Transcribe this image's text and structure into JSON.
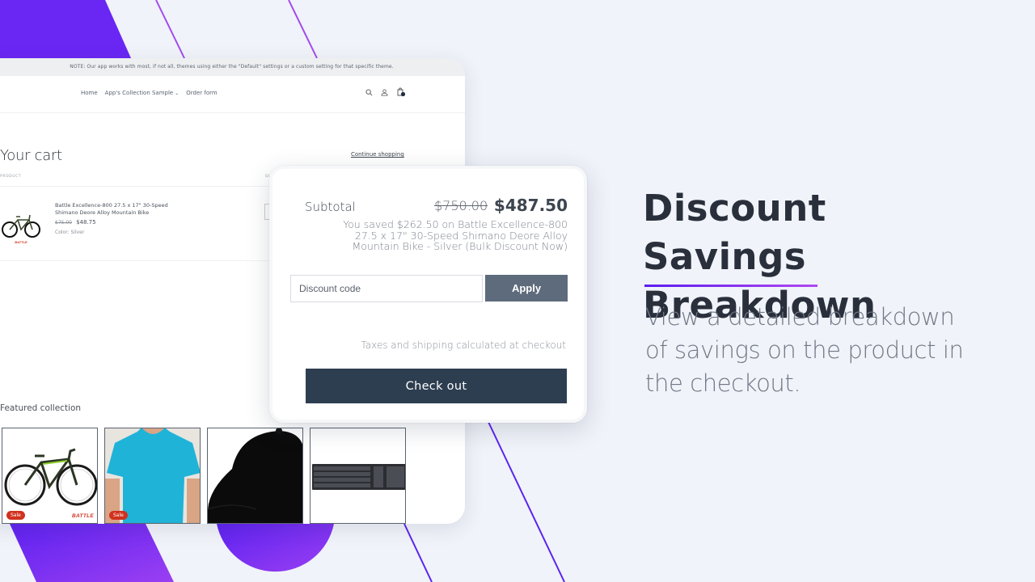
{
  "theme": {
    "accent_purple": "#6a2cf5",
    "checkout_button": "#2e3e51",
    "apply_button": "#5d6b7c",
    "sale_badge": "#d0321f",
    "background": "#f0f3f9"
  },
  "store": {
    "notice": "NOTE: Our app works with most, if not all, themes using either the \"Default\" settings or a custom setting for that specific theme.",
    "nav": {
      "links": [
        {
          "label": "Home"
        },
        {
          "label": "App's Collection Sample",
          "has_dropdown": true
        },
        {
          "label": "Order form"
        }
      ],
      "icons": [
        "search-icon",
        "account-icon",
        "cart-icon"
      ]
    },
    "cart": {
      "title": "Your cart",
      "continue_link": "Continue shopping",
      "columns": {
        "product": "PRODUCT",
        "quantity": "QU"
      },
      "item": {
        "name": "Battle Excellence-800 27.5 x 17\" 30-Speed Shimano Deore Alloy Mountain Bike",
        "old_price": "$75.00",
        "price": "$48.75",
        "variant": "Color: Silver",
        "brand": "BATTLE"
      }
    },
    "featured": {
      "title": "Featured collection",
      "products": [
        {
          "name": "Mountain bike",
          "badge": "Sale",
          "brand": "BATTLE"
        },
        {
          "name": "Turquoise t-shirt",
          "badge": "Sale"
        },
        {
          "name": "Black cap"
        },
        {
          "name": "Keyboard"
        }
      ]
    }
  },
  "popup": {
    "subtotal_label": "Subtotal",
    "original_total": "$750.00",
    "discounted_total": "$487.50",
    "savings_note": "You saved $262.50 on Battle Excellence-800 27.5 x 17\" 30-Speed Shimano Deore Alloy Mountain Bike - Silver (Bulk Discount Now)",
    "discount_placeholder": "Discount code",
    "discount_value": "",
    "apply_label": "Apply",
    "tax_note": "Taxes and shipping calculated at checkout",
    "checkout_label": "Check out"
  },
  "hero": {
    "title": "Discount Savings Breakdown",
    "description": "View a detailed breakdown of savings on the product in the checkout."
  }
}
